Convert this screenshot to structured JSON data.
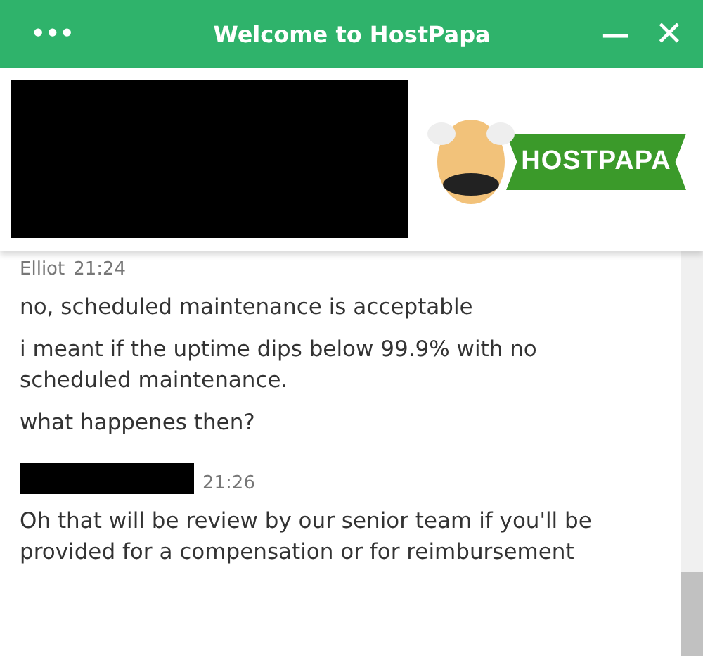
{
  "window": {
    "title": "Welcome to HostPapa",
    "menu_glyph": "•••",
    "minimize_glyph": "—",
    "close_glyph": "✕"
  },
  "banner": {
    "redacted": true,
    "logo": {
      "text": "HOSTPAPA"
    }
  },
  "messages": [
    {
      "author": "Elliot",
      "author_redacted": false,
      "time": "21:24",
      "lines": [
        "no, scheduled maintenance is acceptable",
        "i meant if the uptime dips below 99.9% with no scheduled maintenance.",
        "what happenes then?"
      ]
    },
    {
      "author_redacted": true,
      "time": "21:26",
      "lines": [
        "Oh that will be review by our senior team if you'll be provided for a compensation or for reimbursement"
      ]
    }
  ]
}
